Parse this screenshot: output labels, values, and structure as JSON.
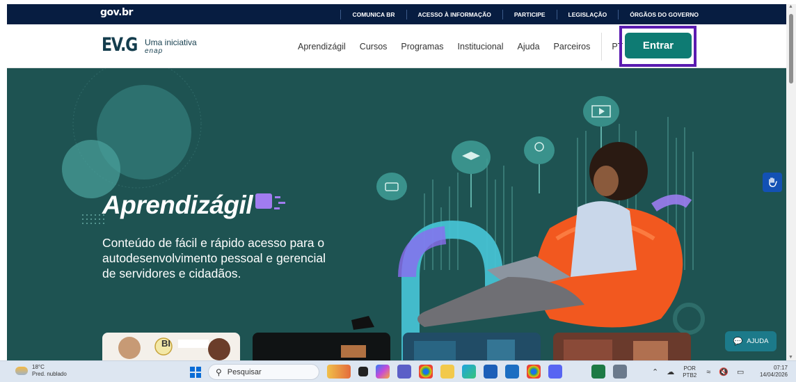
{
  "govbar": {
    "logo": "gov.br",
    "links": [
      "COMUNICA BR",
      "ACESSO À INFORMAÇÃO",
      "PARTICIPE",
      "LEGISLAÇÃO",
      "ÓRGÃOS DO GOVERNO"
    ]
  },
  "header": {
    "logo_main": "EV.G",
    "logo_sub": "Uma iniciativa",
    "logo_org": "enap",
    "nav": [
      "Aprendizágil",
      "Cursos",
      "Programas",
      "Institucional",
      "Ajuda",
      "Parceiros"
    ],
    "language": "PT",
    "login_label": "Entrar",
    "colors": {
      "brand": "#0e7b73",
      "highlight_frame": "#5a1bb0",
      "gov_bar": "#071d41"
    }
  },
  "hero": {
    "title": "Aprendizágil",
    "description": "Conteúdo de fácil e rápido acesso para o autodesenvolvimento pessoal e gerencial de servidores e cidadãos.",
    "card_label": "BI",
    "background": "#1e5352"
  },
  "widgets": {
    "help_label": "AJUDA"
  },
  "taskbar": {
    "weather_temp": "18°C",
    "weather_desc": "Pred. nublado",
    "search_placeholder": "Pesquisar",
    "keyboard_lang": "POR",
    "keyboard_layout": "PTB2",
    "time": "07:17",
    "date": "14/04/2026"
  }
}
